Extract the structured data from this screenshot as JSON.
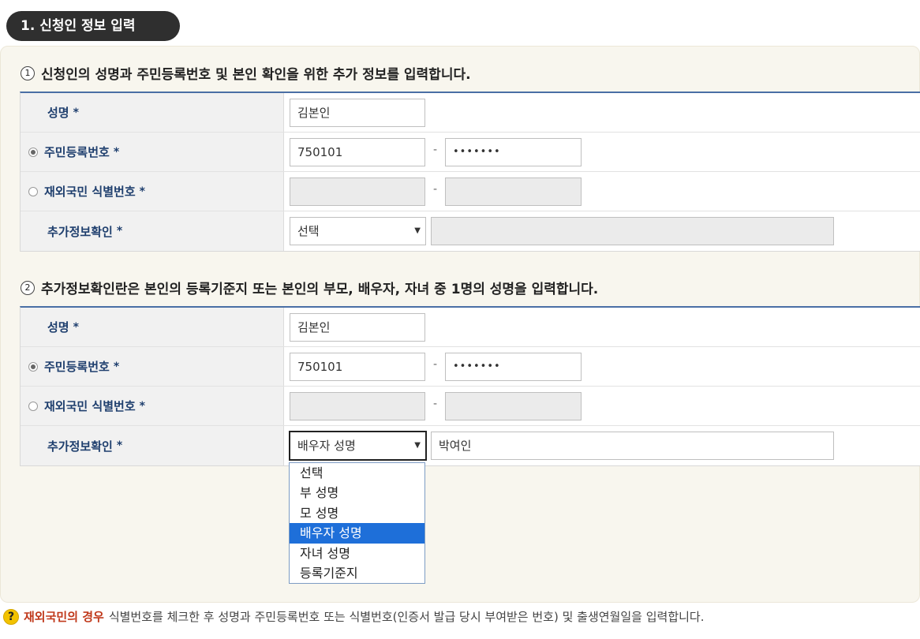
{
  "section": {
    "title": "1. 신청인 정보 입력"
  },
  "q1": {
    "num": "1",
    "title": "신청인의 성명과 주민등록번호 및 본인 확인을 위한 추가 정보를 입력합니다.",
    "rows": {
      "name_label": "성명",
      "name_value": "김본인",
      "rrn_label": "주민등록번호",
      "rrn_front": "750101",
      "rrn_back": "•••••••",
      "foreign_label": "재외국민 식별번호",
      "extra_label": "추가정보확인",
      "extra_select": "선택",
      "extra_value": ""
    }
  },
  "q2": {
    "num": "2",
    "title": "추가정보확인란은 본인의 등록기준지 또는 본인의 부모, 배우자, 자녀 중 1명의 성명을 입력합니다.",
    "rows": {
      "name_label": "성명",
      "name_value": "김본인",
      "rrn_label": "주민등록번호",
      "rrn_front": "750101",
      "rrn_back": "•••••••",
      "foreign_label": "재외국민 식별번호",
      "extra_label": "추가정보확인",
      "extra_select": "배우자 성명",
      "extra_value": "박여인"
    }
  },
  "common": {
    "required_mark": "*",
    "dash": "-",
    "select_arrow": "▼"
  },
  "dropdown": {
    "options": [
      "선택",
      "부 성명",
      "모 성명",
      "배우자 성명",
      "자녀 성명",
      "등록기준지"
    ],
    "selected_index": 3
  },
  "footer": {
    "icon": "?",
    "strong": "재외국민의 경우",
    "text": "식별번호를 체크한 후 성명과 주민등록번호 또는 식별번호(인증서 발급 당시 부여받은 번호) 및 출생연월일을 입력합니다."
  },
  "colors": {
    "accent": "#1f3f6e",
    "table_border": "#4a6fa5",
    "selected_option": "#1e6fd9",
    "warning": "#c0391b"
  }
}
